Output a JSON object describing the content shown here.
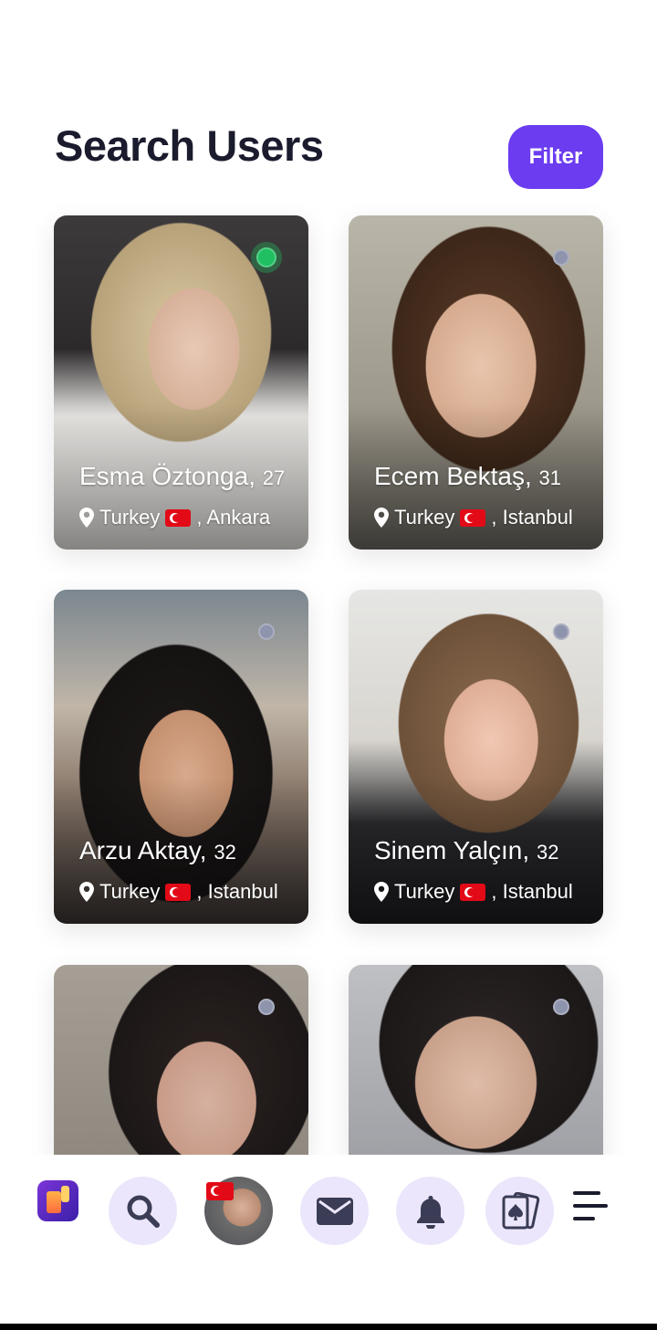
{
  "header": {
    "title": "Search Users",
    "filter_label": "Filter"
  },
  "users": [
    {
      "name": "Esma Öztonga,",
      "age": "27",
      "country": "Turkey",
      "city": ", Ankara",
      "status": "online"
    },
    {
      "name": "Ecem Bektaş,",
      "age": "31",
      "country": "Turkey",
      "city": ", Istanbul",
      "status": "offline"
    },
    {
      "name": "Arzu Aktay,",
      "age": "32",
      "country": "Turkey",
      "city": ", Istanbul",
      "status": "offline"
    },
    {
      "name": "Sinem Yalçın,",
      "age": "32",
      "country": "Turkey",
      "city": ", Istanbul",
      "status": "offline"
    },
    {
      "name": "",
      "age": "",
      "country": "",
      "city": "",
      "status": "offline"
    },
    {
      "name": "",
      "age": "",
      "country": "",
      "city": "",
      "status": "offline"
    }
  ],
  "bottom_nav": {
    "items": [
      "app-logo",
      "search-icon",
      "profile-avatar",
      "mail-icon",
      "bell-icon",
      "cards-icon",
      "menu-icon"
    ]
  },
  "colors": {
    "accent": "#6b3cf0",
    "nav_bubble": "#ebe6fb",
    "online": "#1fbf62",
    "offline": "#8f94ad"
  }
}
